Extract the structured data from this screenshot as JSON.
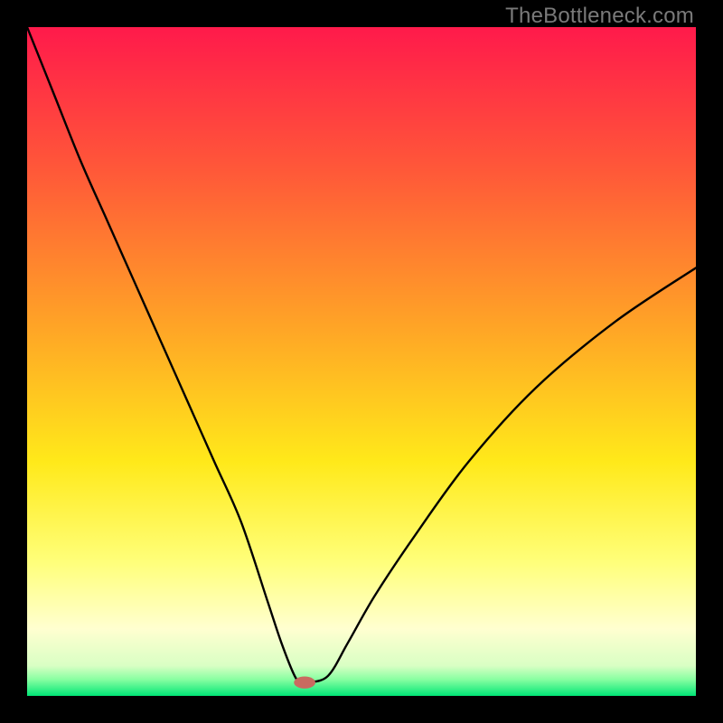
{
  "watermark": "TheBottleneck.com",
  "chart_data": {
    "type": "line",
    "title": "",
    "xlabel": "",
    "ylabel": "",
    "xlim": [
      0,
      100
    ],
    "ylim": [
      0,
      100
    ],
    "grid": false,
    "legend": false,
    "background_gradient": {
      "stops": [
        {
          "offset": 0.0,
          "color": "#ff1a4b"
        },
        {
          "offset": 0.22,
          "color": "#ff5a38"
        },
        {
          "offset": 0.45,
          "color": "#ffa526"
        },
        {
          "offset": 0.65,
          "color": "#ffe91a"
        },
        {
          "offset": 0.8,
          "color": "#ffff7a"
        },
        {
          "offset": 0.9,
          "color": "#ffffd0"
        },
        {
          "offset": 0.955,
          "color": "#d9ffc4"
        },
        {
          "offset": 0.975,
          "color": "#8affa2"
        },
        {
          "offset": 1.0,
          "color": "#00e676"
        }
      ]
    },
    "series": [
      {
        "name": "bottleneck-curve",
        "color": "#000000",
        "width": 2.4,
        "x": [
          0,
          4,
          8,
          12,
          16,
          20,
          24,
          28,
          32,
          36,
          38,
          40,
          41,
          42,
          45,
          48,
          52,
          58,
          66,
          76,
          88,
          100
        ],
        "y": [
          100,
          90,
          80,
          71,
          62,
          53,
          44,
          35,
          26,
          14,
          8,
          3,
          2,
          2,
          3,
          8,
          15,
          24,
          35,
          46,
          56,
          64
        ]
      }
    ],
    "marker": {
      "name": "optimum-point",
      "x": 41.5,
      "y": 2,
      "color": "#c96a60",
      "rx_pct": 1.6,
      "ry_pct": 0.9
    }
  }
}
